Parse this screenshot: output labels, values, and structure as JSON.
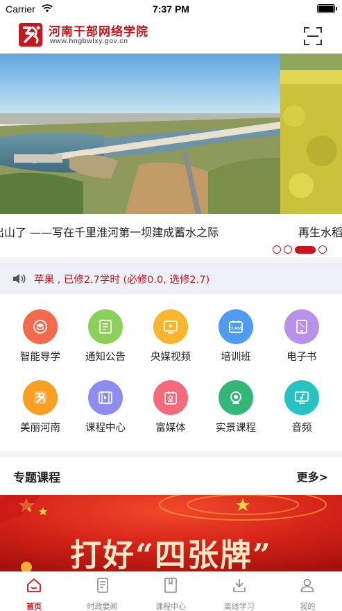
{
  "status": {
    "carrier": "Carrier",
    "time": "7:37 PM"
  },
  "header": {
    "title": "河南干部网络学院",
    "url": "www.hngbwlxy.gov.cn"
  },
  "banner": {
    "caption": "出山了 ——写在千里淮河第一坝建成蓄水之际",
    "next_caption": "再生水稻",
    "slide_count": 4,
    "active_slide": 3
  },
  "notice": {
    "text": "苹果 , 已修2.7学时 (必修0.0, 选修2.7)"
  },
  "grid": {
    "items": [
      {
        "label": "智能导学",
        "icon": "smart-guide-icon",
        "color": "#f46a4e"
      },
      {
        "label": "通知公告",
        "icon": "notice-icon",
        "color": "#8ccf5a"
      },
      {
        "label": "央媒视频",
        "icon": "video-icon",
        "color": "#f9b52c"
      },
      {
        "label": "培训班",
        "icon": "class-icon",
        "color": "#4e9bf0"
      },
      {
        "label": "电子书",
        "icon": "ebook-icon",
        "color": "#b892e8"
      },
      {
        "label": "美丽河南",
        "icon": "henan-icon",
        "color": "#f9a023"
      },
      {
        "label": "课程中心",
        "icon": "course-icon",
        "color": "#8d8cf0"
      },
      {
        "label": "富媒体",
        "icon": "richmedia-icon",
        "color": "#f26a7c"
      },
      {
        "label": "实景课程",
        "icon": "camera-icon",
        "color": "#33b777"
      },
      {
        "label": "音频",
        "icon": "audio-icon",
        "color": "#27c2c2"
      }
    ]
  },
  "section": {
    "title": "专题课程",
    "more": "更多>"
  },
  "promo": {
    "text": "打好“四张牌”"
  },
  "tabs": [
    {
      "label": "首页",
      "icon": "home-icon",
      "active": true
    },
    {
      "label": "时政要闻",
      "icon": "news-icon",
      "active": false
    },
    {
      "label": "课程中心",
      "icon": "course-book-icon",
      "active": false
    },
    {
      "label": "离线学习",
      "icon": "download-icon",
      "active": false
    },
    {
      "label": "我的",
      "icon": "profile-icon",
      "active": false
    }
  ],
  "colors": {
    "brand": "#c8161d",
    "tab_inactive": "#888888"
  }
}
